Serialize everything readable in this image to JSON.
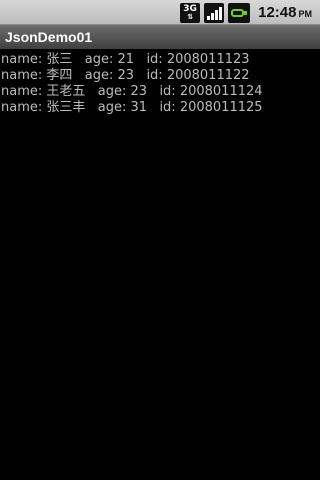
{
  "status_bar": {
    "network_label": "3G",
    "time": "12:48",
    "ampm": "PM",
    "icons": [
      "3g-data-icon",
      "signal-strength-icon",
      "battery-charging-icon"
    ]
  },
  "app": {
    "title": "JsonDemo01"
  },
  "rows": [
    "name: 张三   age: 21   id: 2008011123",
    "name: 李四   age: 23   id: 2008011122",
    "name: 王老五   age: 23   id: 2008011124",
    "name: 张三丰   age: 31   id: 2008011125"
  ],
  "colors": {
    "background": "#000000",
    "text": "#bcbcbc",
    "battery_accent": "#6bd12a"
  }
}
